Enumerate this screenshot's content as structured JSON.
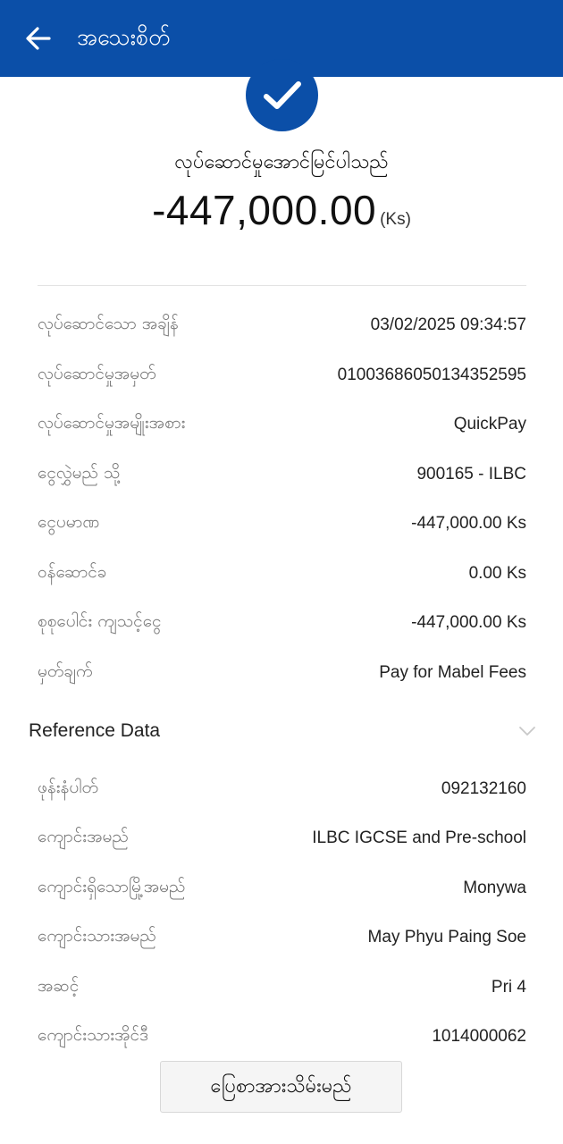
{
  "header": {
    "title": "အသေးစိတ်",
    "back_icon": "arrow-left-icon"
  },
  "summary": {
    "status_icon": "checkmark-icon",
    "status_text": "လုပ်ဆောင်မှုအောင်မြင်ပါသည်",
    "amount": "-447,000.00",
    "currency": "(Ks)"
  },
  "details": [
    {
      "label": "လုပ်ဆောင်သော အချိန်",
      "value": "03/02/2025 09:34:57"
    },
    {
      "label": "လုပ်ဆောင်မှုအမှတ်",
      "value": "01003686050134352595"
    },
    {
      "label": "လုပ်ဆောင်မှုအမျိုးအစား",
      "value": "QuickPay"
    },
    {
      "label": "ငွေလွှဲမည် သို့",
      "value": "900165 - ILBC"
    },
    {
      "label": "ငွေပမာဏ",
      "value": "-447,000.00 Ks"
    },
    {
      "label": "ဝန်ဆောင်ခ",
      "value": "0.00 Ks"
    },
    {
      "label": "စုစုပေါင်း ကျသင့်ငွေ",
      "value": "-447,000.00 Ks"
    },
    {
      "label": "မှတ်ချက်",
      "value": "Pay for Mabel Fees"
    }
  ],
  "reference": {
    "title": "Reference Data",
    "toggle_icon": "chevron-down-icon",
    "items": [
      {
        "label": "ဖုန်းနံပါတ်",
        "value": "092132160"
      },
      {
        "label": "ကျောင်းအမည်",
        "value": "ILBC IGCSE and Pre-school"
      },
      {
        "label": "ကျောင်းရှိသောမြို့အမည်",
        "value": "Monywa"
      },
      {
        "label": "ကျောင်းသားအမည်",
        "value": "May Phyu Paing Soe"
      },
      {
        "label": "အဆင့်",
        "value": "Pri 4"
      },
      {
        "label": "ကျောင်းသားအိုင်ဒီ",
        "value": "1014000062"
      }
    ]
  },
  "actions": {
    "save_label": "ပြေစာအားသိမ်းမည်"
  },
  "colors": {
    "brand": "#0b4fa8",
    "text": "#222222",
    "muted": "#777777"
  }
}
